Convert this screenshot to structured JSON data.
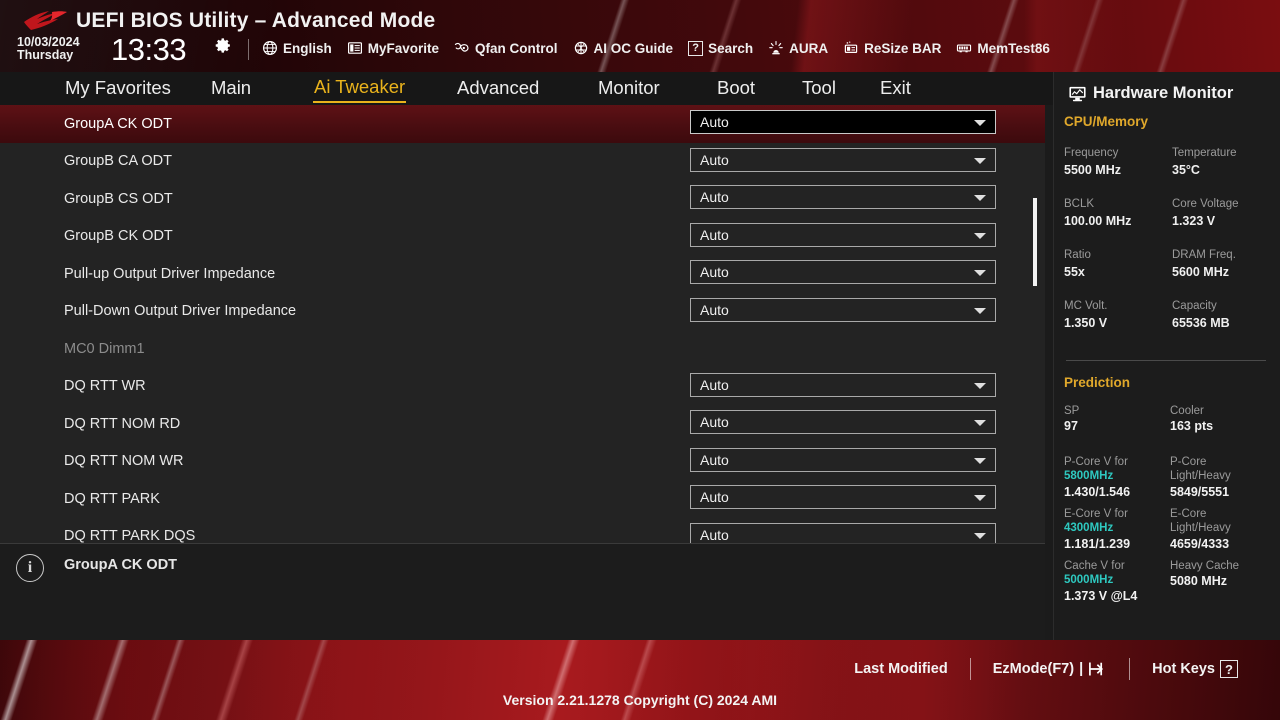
{
  "header": {
    "logo_icon": "rog-logo-icon",
    "title": "UEFI BIOS Utility – Advanced Mode",
    "date": "10/03/2024",
    "weekday": "Thursday",
    "time": "13:33",
    "gear_icon": "gear-icon",
    "toolbar": [
      {
        "label": "English",
        "icon": "globe-icon"
      },
      {
        "label": "MyFavorite",
        "icon": "favorites-list-icon"
      },
      {
        "label": "Qfan Control",
        "icon": "fan-icon"
      },
      {
        "label": "AI OC Guide",
        "icon": "ai-chip-icon"
      },
      {
        "label": "Search",
        "icon": "question-box-icon"
      },
      {
        "label": "AURA",
        "icon": "aura-light-icon"
      },
      {
        "label": "ReSize BAR",
        "icon": "resize-bar-icon"
      },
      {
        "label": "MemTest86",
        "icon": "memtest-icon"
      }
    ]
  },
  "nav": {
    "items": [
      {
        "label": "My Favorites",
        "active": false
      },
      {
        "label": "Main",
        "active": false
      },
      {
        "label": "Ai Tweaker",
        "active": true
      },
      {
        "label": "Advanced",
        "active": false
      },
      {
        "label": "Monitor",
        "active": false
      },
      {
        "label": "Boot",
        "active": false
      },
      {
        "label": "Tool",
        "active": false
      },
      {
        "label": "Exit",
        "active": false
      }
    ]
  },
  "settings_list": {
    "rows": [
      {
        "label": "GroupA CK ODT",
        "value": "Auto",
        "type": "dropdown",
        "selected": true
      },
      {
        "label": "GroupB CA ODT",
        "value": "Auto",
        "type": "dropdown",
        "selected": false
      },
      {
        "label": "GroupB CS ODT",
        "value": "Auto",
        "type": "dropdown",
        "selected": false
      },
      {
        "label": "GroupB CK ODT",
        "value": "Auto",
        "type": "dropdown",
        "selected": false
      },
      {
        "label": "Pull-up Output Driver Impedance",
        "value": "Auto",
        "type": "dropdown",
        "selected": false
      },
      {
        "label": "Pull-Down Output Driver Impedance",
        "value": "Auto",
        "type": "dropdown",
        "selected": false
      },
      {
        "label": "MC0 Dimm1",
        "value": "",
        "type": "section",
        "selected": false
      },
      {
        "label": "DQ RTT WR",
        "value": "Auto",
        "type": "dropdown",
        "selected": false
      },
      {
        "label": "DQ RTT NOM RD",
        "value": "Auto",
        "type": "dropdown",
        "selected": false
      },
      {
        "label": "DQ RTT NOM WR",
        "value": "Auto",
        "type": "dropdown",
        "selected": false
      },
      {
        "label": "DQ RTT PARK",
        "value": "Auto",
        "type": "dropdown",
        "selected": false
      },
      {
        "label": "DQ RTT PARK DQS",
        "value": "Auto",
        "type": "dropdown",
        "selected": false
      }
    ],
    "scrollbar_present": true
  },
  "help_bar": {
    "icon": "info-icon",
    "text": "GroupA CK ODT"
  },
  "hardware_monitor": {
    "icon": "monitor-icon",
    "title": "Hardware Monitor",
    "cpu_memory": {
      "section_label": "CPU/Memory",
      "pairs": [
        [
          {
            "key": "Frequency",
            "value": "5500 MHz"
          },
          {
            "key": "Temperature",
            "value": "35°C"
          }
        ],
        [
          {
            "key": "BCLK",
            "value": "100.00 MHz"
          },
          {
            "key": "Core Voltage",
            "value": "1.323 V"
          }
        ],
        [
          {
            "key": "Ratio",
            "value": "55x"
          },
          {
            "key": "DRAM Freq.",
            "value": "5600 MHz"
          }
        ],
        [
          {
            "key": "MC Volt.",
            "value": "1.350 V"
          },
          {
            "key": "Capacity",
            "value": "65536 MB"
          }
        ]
      ]
    },
    "prediction": {
      "section_label": "Prediction",
      "sp": {
        "key": "SP",
        "value": "97"
      },
      "cooler": {
        "key": "Cooler",
        "value": "163 pts"
      },
      "pcore": {
        "key_a": "P-Core V for",
        "key_freq": "5800MHz",
        "value_a": "1.430/1.546",
        "key_b1": "P-Core",
        "key_b2": "Light/Heavy",
        "value_b": "5849/5551"
      },
      "ecore": {
        "key_a": "E-Core V for",
        "key_freq": "4300MHz",
        "value_a": "1.181/1.239",
        "key_b1": "E-Core",
        "key_b2": "Light/Heavy",
        "value_b": "4659/4333"
      },
      "cache": {
        "key_a": "Cache V for",
        "key_freq": "5000MHz",
        "value_a": "1.373 V @L4",
        "key_b1": "Heavy Cache",
        "value_b": "5080 MHz"
      }
    }
  },
  "footer": {
    "last_modified": "Last Modified",
    "ezmode": "EzMode(F7)",
    "ezmode_icon": "exit-arrow-icon",
    "hotkeys": "Hot Keys",
    "hotkeys_icon": "question-box-icon",
    "version": "Version 2.21.1278 Copyright (C) 2024 AMI"
  },
  "colors": {
    "accent_gold": "#eab31c",
    "accent_teal": "#2ec9c0",
    "selected_row_red": "#4a0d11",
    "panel_bg": "#1c1c1c",
    "list_bg": "#232323"
  }
}
